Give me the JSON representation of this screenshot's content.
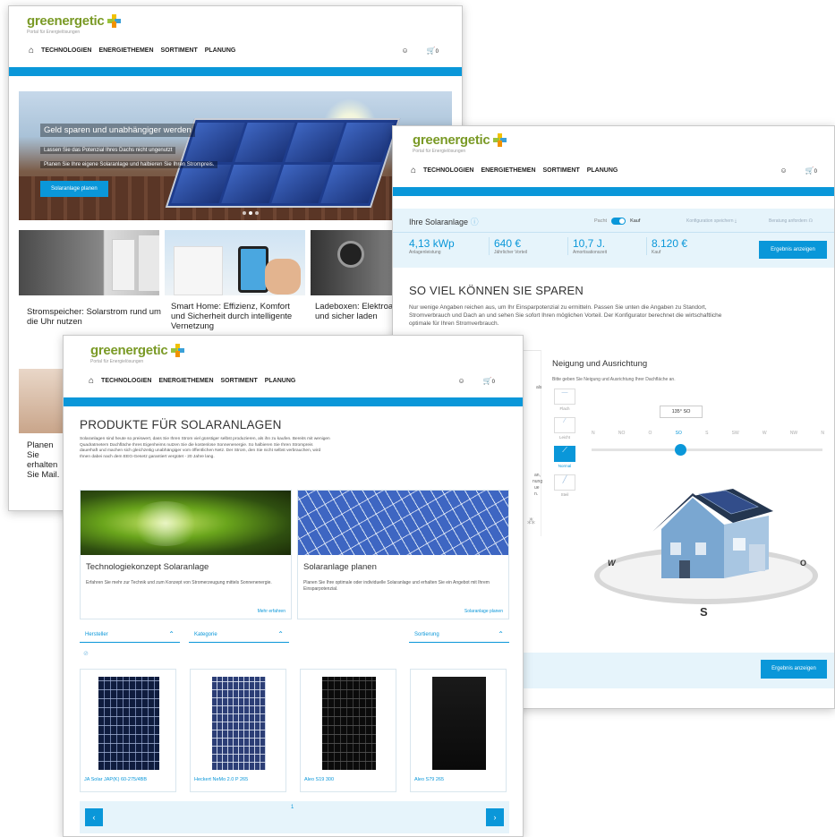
{
  "brand": {
    "name": "greenergetic",
    "tagline": "Portal für Energielösungen"
  },
  "nav": {
    "items": [
      "TECHNOLOGIEN",
      "ENERGIETHEMEN",
      "SORTIMENT",
      "PLANUNG"
    ],
    "cart_count": "0",
    "user_icon": "user-icon",
    "cart_icon": "cart-icon",
    "home_icon": "home-icon"
  },
  "colors": {
    "accent": "#0a97d9",
    "brand_green": "#7a9a26",
    "panel_bg": "#e6f4fb"
  },
  "window1": {
    "hero": {
      "title": "Geld sparen und unabhängiger werden",
      "line1": "Lassen Sie das Potenzial Ihres Dachs nicht ungenutzt",
      "line2": "Planen Sie Ihre eigene Solaranlage und halbieren Sie Ihren Strompreis.",
      "button": "Solaranlage planen"
    },
    "cards": [
      {
        "title": "Stromspeicher: Solarstrom rund um die Uhr nutzen"
      },
      {
        "title": "Smart Home: Effizienz, Komfort und Sicherheit durch intelligente Vernetzung"
      },
      {
        "title": "Ladeboxen: Elektroauto schneller und sicher laden"
      }
    ],
    "lower_card_text": "Planen Sie erhalten Sie Mail."
  },
  "window2": {
    "panel_title": "Ihre Solaranlage",
    "info_icon": "info-icon",
    "toggle": {
      "left": "Pacht",
      "right": "Kauf"
    },
    "save_label": "Konfiguration speichern",
    "advice_label": "Beratung anfordern",
    "stats": [
      {
        "value": "4,13 kWp",
        "label": "Anlagenleistung"
      },
      {
        "value": "640 €",
        "label": "Jährlicher Vorteil"
      },
      {
        "value": "10,7 J.",
        "label": "Amortisationszeit"
      },
      {
        "value": "8.120 €",
        "label": "Kauf"
      }
    ],
    "result_button": "Ergebnis anzeigen",
    "headline": "SO VIEL KÖNNEN SIE SPAREN",
    "intro": "Nur wenige Angaben reichen aus, um Ihr Einsparpotenzial zu ermitteln. Passen Sie unten die Angaben zu Standort, Stromverbrauch und Dach an und sehen Sie sofort Ihren möglichen Vorteil. Der Konfigurator berechnet die wirtschaftliche optimale für Ihren Stromverbrauch.",
    "tilt": {
      "title": "Neigung und Ausrichtung",
      "hint": "Bitte geben Sie Neigung und Ausrichtung Ihrer Dachfläche an.",
      "options": [
        "Flach",
        "Leicht",
        "Normal",
        "Steil"
      ],
      "selected": "Normal"
    },
    "orientation": {
      "value": "135° SO",
      "labels": [
        "N",
        "NO",
        "O",
        "SO",
        "S",
        "SW",
        "W",
        "NW",
        "N"
      ],
      "selected": "SO"
    },
    "compass": {
      "w": "W",
      "o": "O",
      "s": "S"
    },
    "left_fragments": [
      "als",
      "an,",
      "nung",
      "ue",
      "n."
    ]
  },
  "window3": {
    "headline": "PRODUKTE FÜR SOLARANLAGEN",
    "intro": "Solaranlagen sind heute so preiswert, dass Sie Ihren Strom viel günstiger selbst produzieren, als ihn zu kaufen. Bereits mit wenigen Quadratmetern Dachfläche Ihres Eigenheims nutzen Sie die kostenlose Sonnenenergie. So halbieren Sie Ihren Strompreis dauerhaft und machen sich gleichzeitig unabhängiger vom öffentlichen Netz. Der Strom, den Sie nicht selbst verbrauchen, wird Ihnen dabei nach dem EEG-Gesetz garantiert vergütet - 20 Jahre lang.",
    "teasers": [
      {
        "title": "Technologiekonzept Solaranlage",
        "text": "Erfahren Sie mehr zur Technik und zum Konzept von Stromerzeugung mittels Sonnenenergie.",
        "link": "Mehr erfahren"
      },
      {
        "title": "Solaranlage planen",
        "text": "Planen Sie Ihre optimale oder individuelle Solaranlage und erhalten Sie ein Angebot mit Ihrem Einsparpotenzial.",
        "link": "Solaranlage planen"
      }
    ],
    "filters": [
      "Hersteller",
      "Kategorie",
      "Sortierung"
    ],
    "products": [
      "JA Solar JAP(K) 60-275/4BB",
      "Heckert NeMo 2.0 P 265",
      "Aleo S19 300",
      "Aleo S79 265"
    ],
    "page": "1",
    "prev": "‹",
    "next": "›"
  }
}
